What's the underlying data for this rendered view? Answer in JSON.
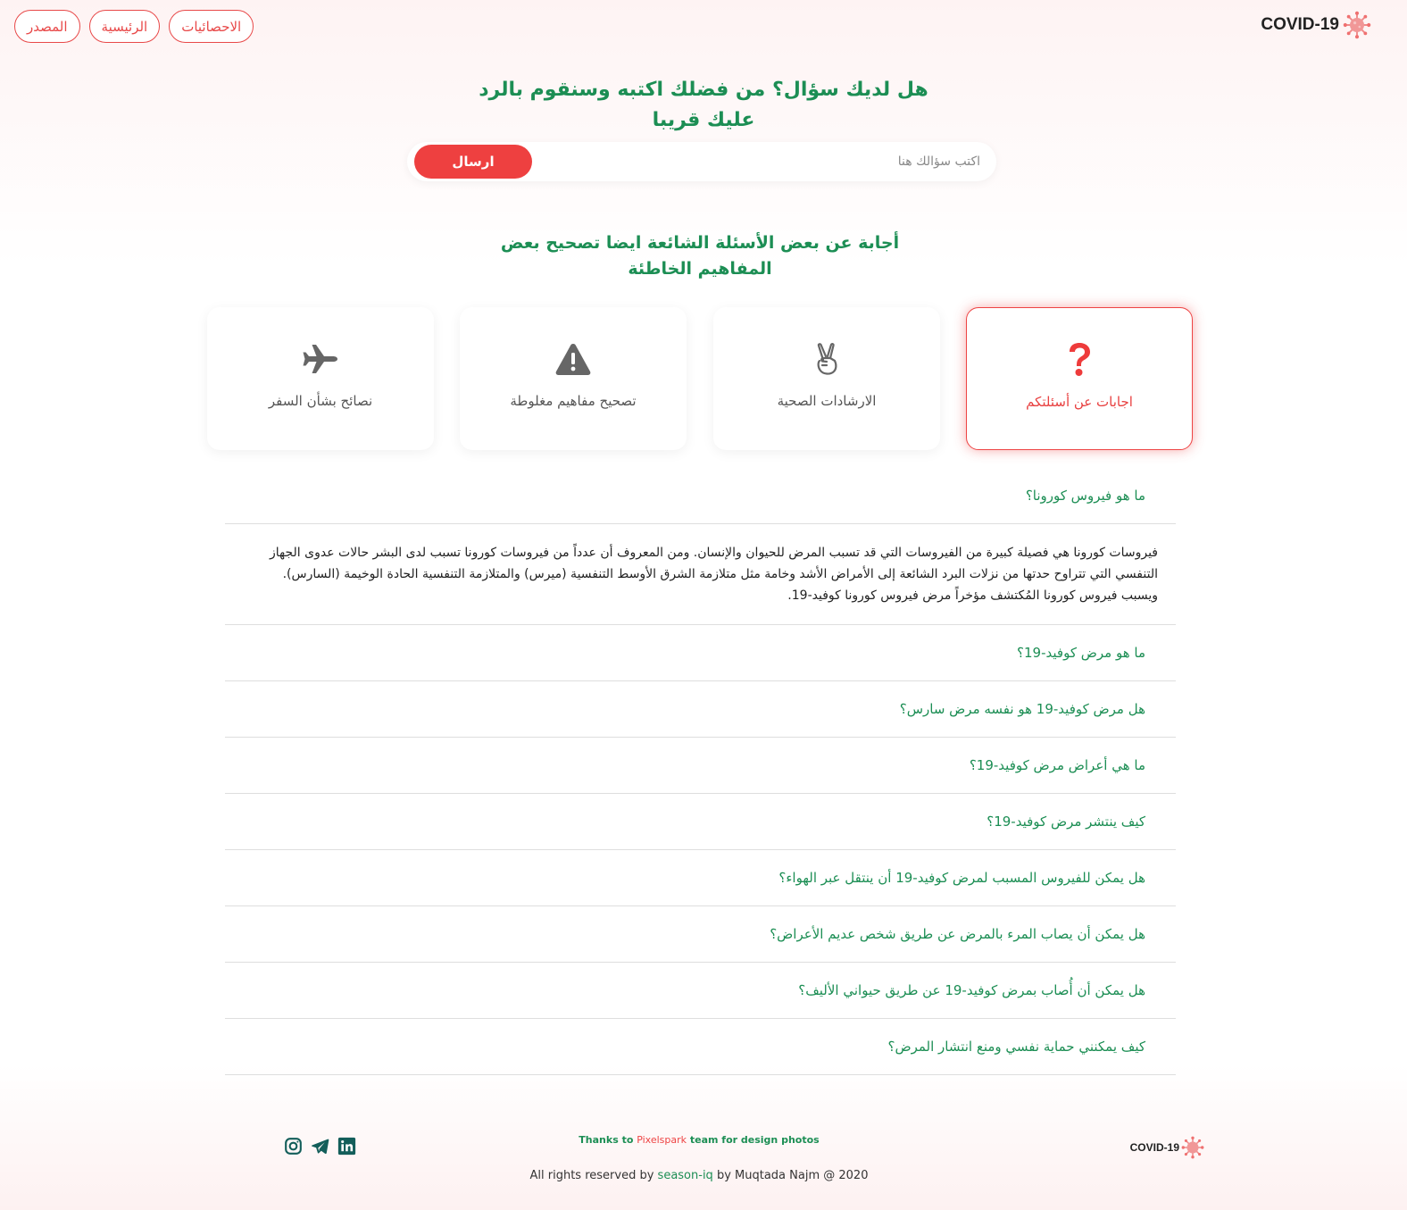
{
  "nav": {
    "buttons": [
      "المصدر",
      "الرئيسية",
      "الاحصائيات"
    ]
  },
  "brand": {
    "name": "COVID-19",
    "icon": "virus-icon"
  },
  "ask": {
    "title": "هل لديك سؤال؟ من فضلك اكتبه وسنقوم بالرد عليك قريبا",
    "placeholder": "اكتب سؤالك هنا",
    "send_label": "ارسال"
  },
  "faq_heading": "أجابة عن بعض الأسئلة الشائعة ايضا تصحيح بعض المفاهيم الخاطئة",
  "cards": [
    {
      "label": "اجابات عن أسئلتكم",
      "icon": "question-icon",
      "active": true
    },
    {
      "label": "الارشادات الصحية",
      "icon": "victory-hand-icon",
      "active": false
    },
    {
      "label": "تصحيح مفاهيم مغلوطة",
      "icon": "warning-icon",
      "active": false
    },
    {
      "label": "نصائح بشأن السفر",
      "icon": "airplane-icon",
      "active": false
    }
  ],
  "faq": [
    {
      "q": "ما هو فيروس كورونا؟",
      "a": "فيروسات كورونا هي فصيلة كبيرة من الفيروسات التي قد تسبب المرض للحيوان والإنسان. ومن المعروف أن عدداً من فيروسات كورونا تسبب لدى البشر حالات عدوى الجهاز التنفسي التي تتراوح حدتها من نزلات البرد الشائعة إلى الأمراض الأشد وخامة مثل متلازمة الشرق الأوسط التنفسية (ميرس) والمتلازمة التنفسية الحادة الوخيمة (السارس). ويسبب فيروس كورونا المُكتشف مؤخراً مرض فيروس كورونا كوفيد-19."
    },
    {
      "q": "ما هو مرض كوفيد-19؟"
    },
    {
      "q": "هل مرض كوفيد-19 هو نفسه مرض سارس؟"
    },
    {
      "q": "ما هي أعراض مرض كوفيد-19؟"
    },
    {
      "q": "كيف ينتشر مرض كوفيد-19؟"
    },
    {
      "q": "هل يمكن للفيروس المسبب لمرض كوفيد-19 أن ينتقل عبر الهواء؟"
    },
    {
      "q": "هل يمكن أن يصاب المرء بالمرض عن طريق شخص عديم الأعراض؟"
    },
    {
      "q": "هل يمكن أن أُصاب بمرض كوفيد-19 عن طريق حيواني الأليف؟"
    },
    {
      "q": "كيف يمكنني حماية نفسي ومنع انتشار المرض؟"
    }
  ],
  "footer": {
    "credits_pre": "Thanks to ",
    "credits_link": "Pixelspark",
    "credits_post": " team for design photos",
    "rights_pre": "All rights reserved by ",
    "rights_link": "season-iq",
    "rights_post": " by Muqtada Najm @ 2020",
    "socials": [
      "instagram-icon",
      "telegram-icon",
      "linkedin-icon"
    ]
  },
  "colors": {
    "accent_red": "#ee4040",
    "accent_green": "#1c8e54",
    "social_teal": "#135e5a"
  }
}
